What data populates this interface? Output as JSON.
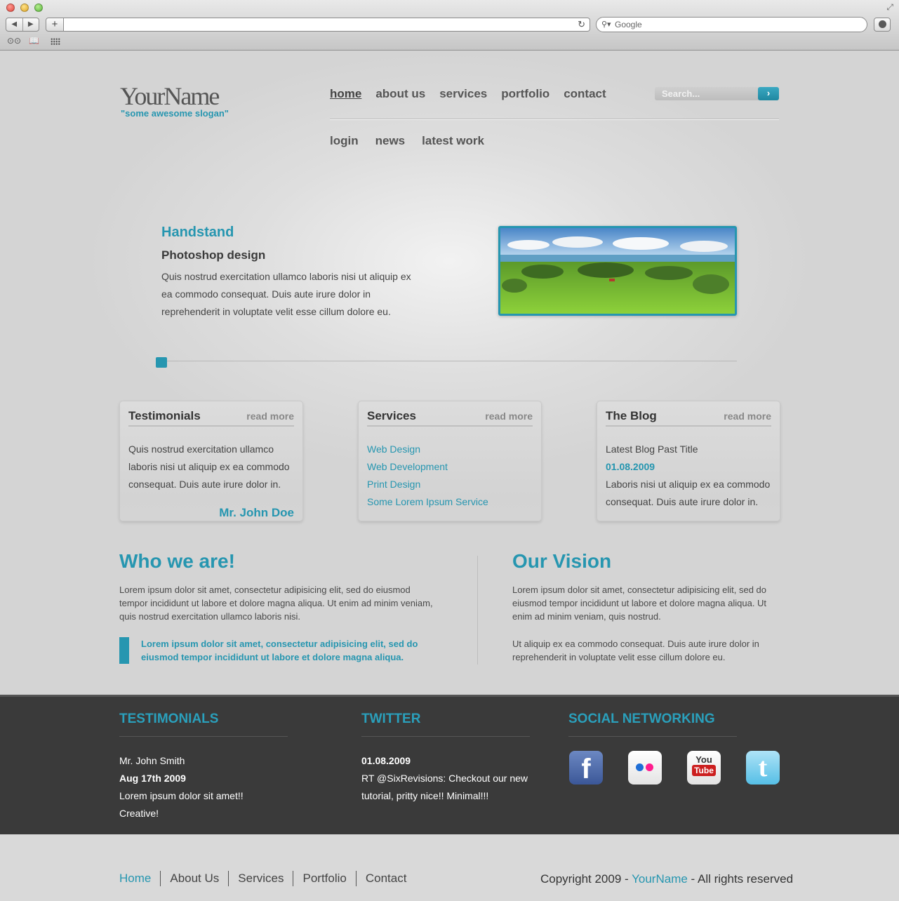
{
  "browser": {
    "search_placeholder": "Google",
    "icons": [
      "back-icon",
      "forward-icon",
      "add-tab-icon",
      "reload-icon",
      "search-icon",
      "download-icon",
      "reading-list-icon",
      "bookmarks-icon",
      "top-sites-icon",
      "fullscreen-icon"
    ]
  },
  "site": {
    "logo": "YourName",
    "slogan": "\"some awesome slogan\"",
    "search_placeholder": "Search...",
    "nav_primary": [
      "home",
      "about us",
      "services",
      "portfolio",
      "contact"
    ],
    "nav_secondary": [
      "login",
      "news",
      "latest work"
    ]
  },
  "slide": {
    "title": "Handstand",
    "subtitle": "Photoshop design",
    "text": "Quis nostrud exercitation ullamco laboris nisi ut aliquip ex ea commodo consequat. Duis aute irure dolor in reprehenderit in voluptate velit esse cillum dolore eu."
  },
  "boxes": {
    "read_more": "read more",
    "testimonials": {
      "title": "Testimonials",
      "text": "Quis nostrud exercitation ullamco laboris nisi ut aliquip ex ea commodo consequat. Duis aute irure dolor in.",
      "author": "Mr. John Doe"
    },
    "services": {
      "title": "Services",
      "items": [
        "Web Design",
        "Web Development",
        "Print Design",
        "Some Lorem Ipsum Service"
      ]
    },
    "blog": {
      "title": "The Blog",
      "post_title": "Latest Blog Past Title",
      "date": "01.08.2009",
      "text": "Laboris nisi ut aliquip ex ea commodo consequat. Duis aute irure dolor in."
    }
  },
  "about": {
    "who_title": "Who we are!",
    "who_text": "Lorem ipsum dolor sit amet, consectetur adipisicing elit, sed do eiusmod tempor incididunt ut labore et dolore magna aliqua. Ut enim ad minim veniam, quis nostrud exercitation ullamco laboris nisi.",
    "who_quote": "Lorem ipsum dolor sit amet, consectetur adipisicing elit, sed do eiusmod tempor incididunt ut labore et dolore magna aliqua.",
    "vision_title": "Our Vision",
    "vision_text_1": "Lorem ipsum dolor sit amet, consectetur adipisicing elit, sed do eiusmod tempor incididunt ut labore et dolore magna aliqua. Ut enim ad minim veniam, quis nostrud.",
    "vision_text_2": "Ut aliquip ex ea commodo consequat. Duis aute irure dolor in reprehenderit in voluptate velit esse cillum dolore eu."
  },
  "footer": {
    "testimonials_title": "TESTIMONIALS",
    "testimonial_name": "Mr. John Smith",
    "testimonial_date": "Aug 17th 2009",
    "testimonial_line1": "Lorem ipsum dolor sit amet!!",
    "testimonial_line2": "Creative!",
    "twitter_title": "TWITTER",
    "tweet_date": "01.08.2009",
    "tweet_line1": "RT @SixRevisions: Checkout our new",
    "tweet_line2": "tutorial, pritty nice!! Minimal!!!",
    "social_title": "SOCIAL NETWORKING",
    "social_icons": [
      "facebook-icon",
      "flickr-icon",
      "youtube-icon",
      "twitter-icon"
    ],
    "youtube_you": "You",
    "youtube_tube": "Tube"
  },
  "bottom": {
    "nav": [
      "Home",
      "About Us",
      "Services",
      "Portfolio",
      "Contact"
    ],
    "copy_prefix": "Copyright 2009 - ",
    "copy_brand": "YourName",
    "copy_suffix": " - All rights reserved"
  },
  "colors": {
    "accent": "#2696b0",
    "footer_bg": "#3a3a3a",
    "page_bg": "#d8d8d8"
  }
}
